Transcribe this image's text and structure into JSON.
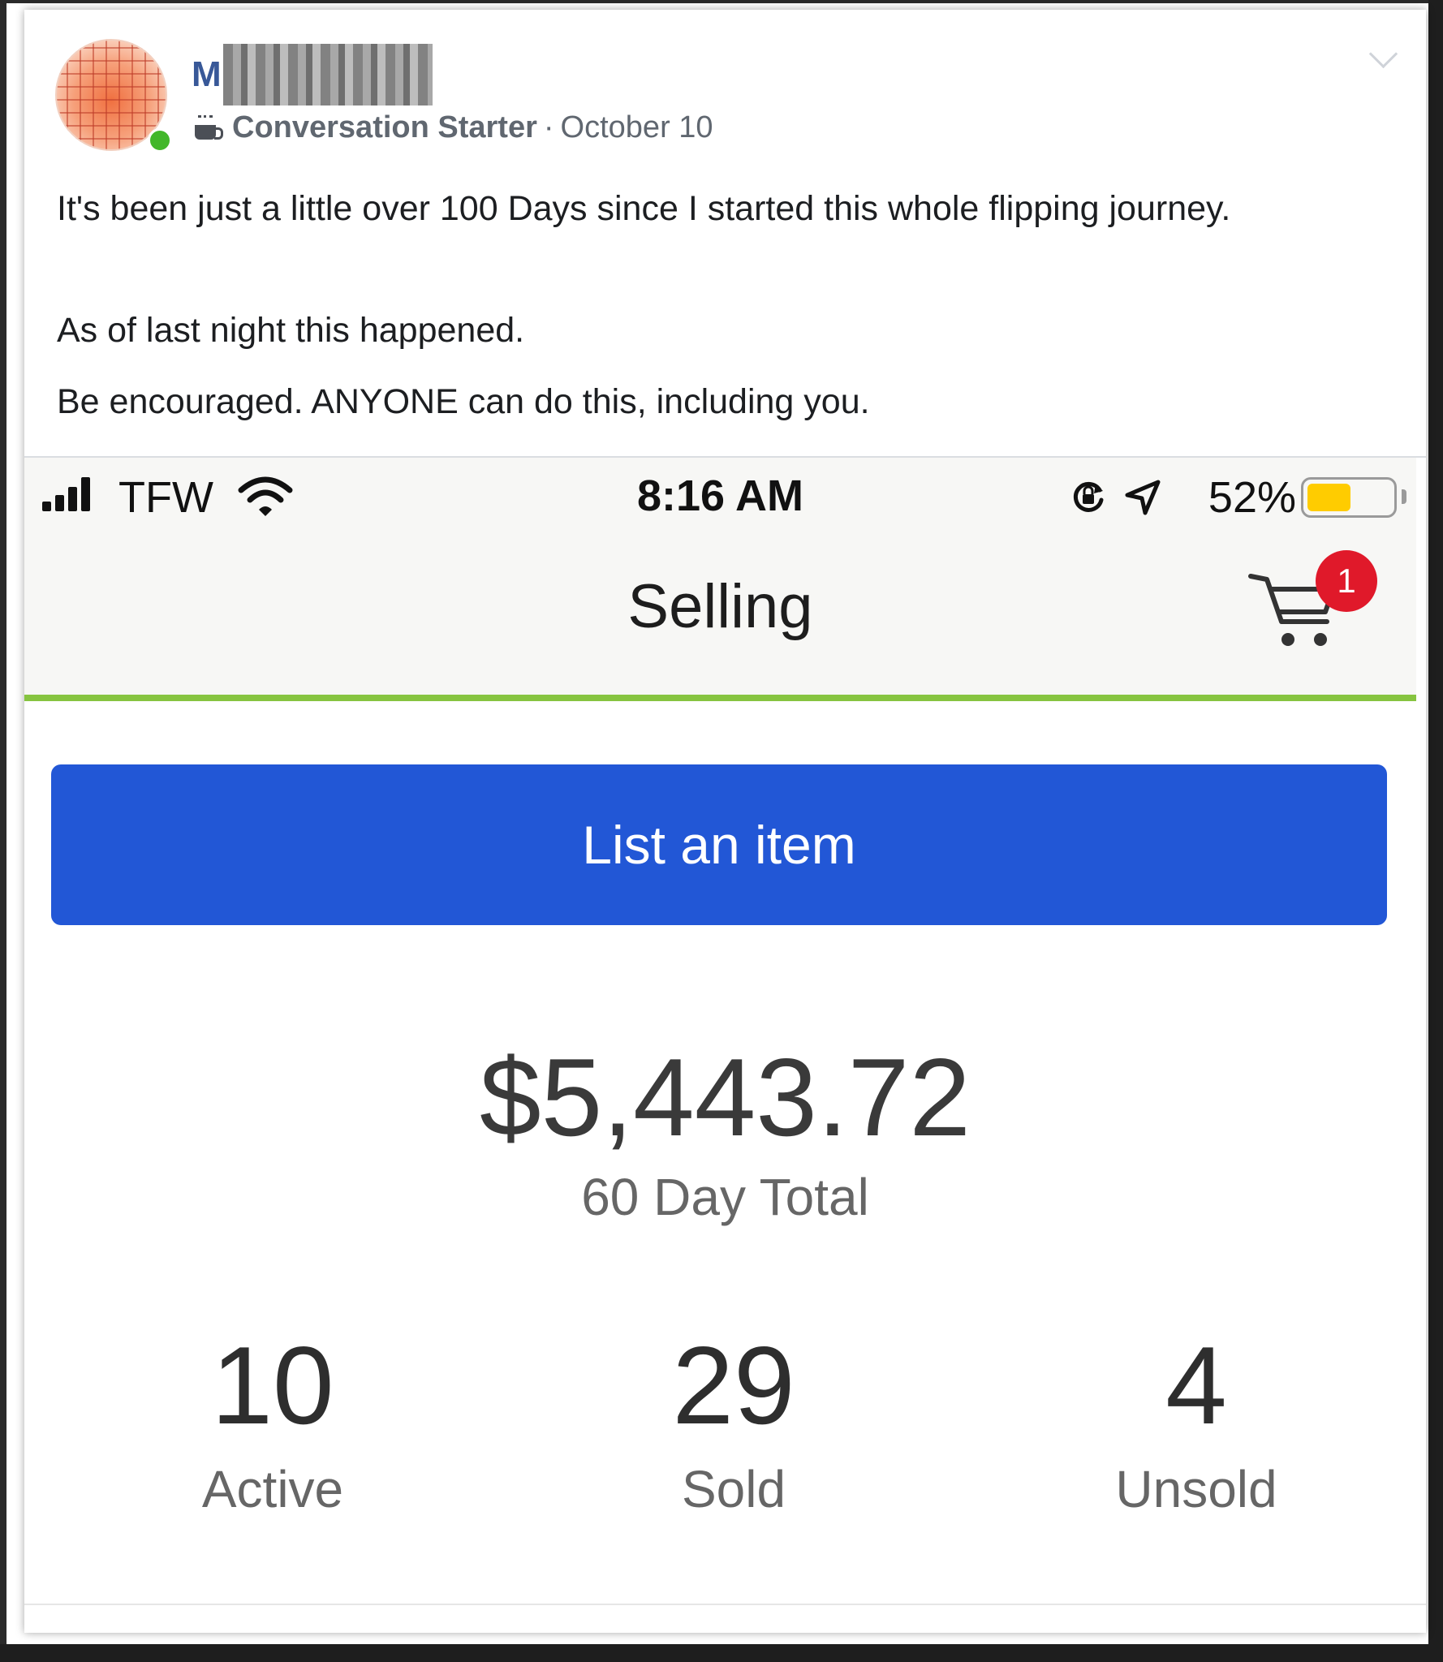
{
  "post": {
    "author_visible": "M",
    "badge_label": "Conversation Starter",
    "separator": "·",
    "date": "October 10",
    "paragraphs": [
      "It's been just a little over 100 Days since I started this whole flipping journey.",
      "As of last night this happened.",
      "Be encouraged. ANYONE can do this, including you."
    ]
  },
  "status_bar": {
    "carrier": "TFW",
    "time": "8:16 AM",
    "battery_percent": "52%",
    "battery_level": 0.52
  },
  "app": {
    "title": "Selling",
    "cart_count": "1",
    "list_button_label": "List an item",
    "total_amount": "$5,443.72",
    "total_label": "60 Day Total",
    "stats": [
      {
        "value": "10",
        "label": "Active"
      },
      {
        "value": "29",
        "label": "Sold"
      },
      {
        "value": "4",
        "label": "Unsold"
      }
    ]
  },
  "colors": {
    "accent_blue": "#2257d6",
    "green_rule": "#86c440",
    "badge_red": "#e0192a",
    "battery_yellow": "#ffcc00",
    "fb_link_blue": "#385898"
  },
  "icons": {
    "avatar": "profile-avatar",
    "online": "online-status-dot",
    "badge": "coffee-cup-icon",
    "menu": "chevron-down-icon",
    "signal": "signal-bars-icon",
    "wifi": "wifi-icon",
    "rotation_lock": "rotation-lock-icon",
    "location": "location-arrow-icon",
    "battery": "battery-icon",
    "cart": "shopping-cart-icon"
  }
}
